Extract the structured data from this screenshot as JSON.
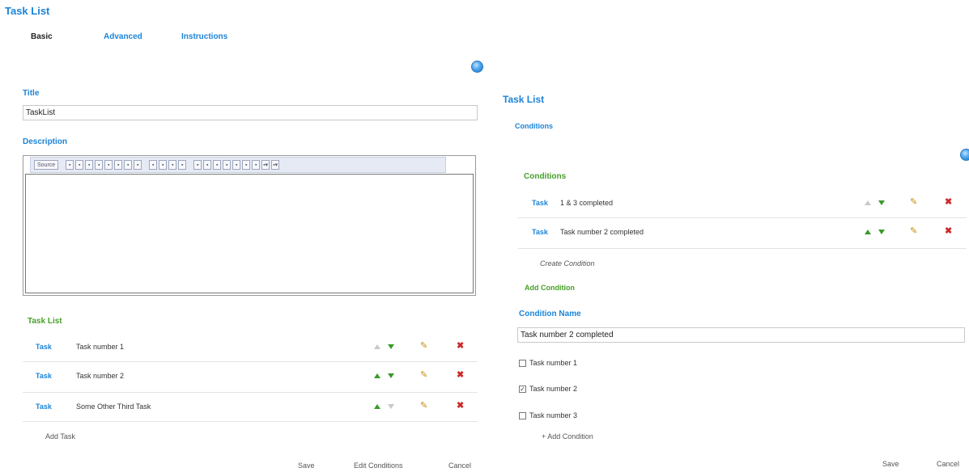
{
  "app_title": "Task List",
  "tabs": [
    {
      "label": "Basic",
      "active": true
    },
    {
      "label": "Advanced",
      "active": false
    },
    {
      "label": "Instructions",
      "active": false
    }
  ],
  "form": {
    "title_label": "Title",
    "title_value": "TaskList",
    "description_label": "Description",
    "toolbar_source_label": "Source"
  },
  "task_list": {
    "heading": "Task List",
    "rows": [
      {
        "link": "Task",
        "text": "Task number 1",
        "up_enabled": false,
        "down_enabled": true
      },
      {
        "link": "Task",
        "text": "Task number 2",
        "up_enabled": true,
        "down_enabled": true
      },
      {
        "link": "Task",
        "text": "Some Other Third Task",
        "up_enabled": true,
        "down_enabled": false
      }
    ],
    "add_label": "Add Task"
  },
  "left_footer": {
    "save": "Save",
    "edit_conditions": "Edit Conditions",
    "cancel": "Cancel"
  },
  "right_panel": {
    "title": "Task List",
    "subtitle": "Conditions",
    "conditions_heading": "Conditions",
    "rows": [
      {
        "link": "Task",
        "text": "1 & 3 completed",
        "up_enabled": false,
        "down_enabled": true
      },
      {
        "link": "Task",
        "text": "Task number 2 completed",
        "up_enabled": true,
        "down_enabled": true
      }
    ],
    "create_condition": "Create Condition",
    "add_condition_heading": "Add Condition",
    "condition_name_label": "Condition Name",
    "condition_name_value": "Task number 2 completed",
    "checkboxes": [
      {
        "label": "Task number 1",
        "checked": false
      },
      {
        "label": "Task number 2",
        "checked": true
      },
      {
        "label": "Task number 3",
        "checked": false
      }
    ],
    "add_condition_link": "+ Add Condition",
    "save": "Save",
    "cancel": "Cancel"
  },
  "colors": {
    "accent_blue": "#1b84d8",
    "accent_green": "#47a02a",
    "delete_red": "#cc2a2a",
    "edit_orange": "#c98b00"
  },
  "icons": {
    "add_circle": "blue-plus-circle-icon",
    "move_up": "arrow-up-icon",
    "move_down": "arrow-down-icon",
    "edit": "pencil-icon",
    "delete": "delete-x-icon"
  }
}
